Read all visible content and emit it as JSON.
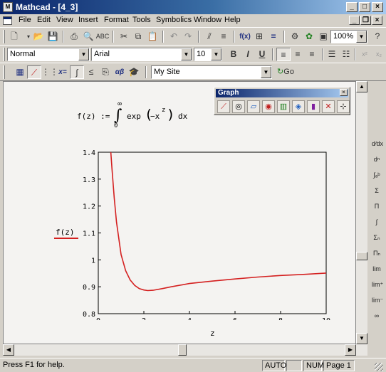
{
  "window": {
    "title": "Mathcad - [4_3]"
  },
  "menu": [
    "File",
    "Edit",
    "View",
    "Insert",
    "Format",
    "Tools",
    "Symbolics",
    "Window",
    "Help"
  ],
  "format_bar": {
    "style": "Normal",
    "font": "Arial",
    "size": "10"
  },
  "standard_bar": {
    "zoom": "100%"
  },
  "resources_bar": {
    "site": "My Site",
    "go_label": "Go"
  },
  "graph_toolbar": {
    "title": "Graph"
  },
  "equation": {
    "lhs": "f(z) :=",
    "integrand": "exp",
    "arg": "−x",
    "power": "z",
    "dx": "dx",
    "upper": "∞",
    "lower": "0"
  },
  "plot": {
    "ylabel": "f(z)",
    "xlabel": "z"
  },
  "chart_data": {
    "type": "line",
    "title": "",
    "xlabel": "z",
    "ylabel": "f(z)",
    "xlim": [
      0,
      10
    ],
    "ylim": [
      0.8,
      1.4
    ],
    "x_ticks": [
      "0",
      "2",
      "4",
      "6",
      "8",
      "10"
    ],
    "y_ticks": [
      "0.8",
      "0.9",
      "1",
      "1.1",
      "1.2",
      "1.3",
      "1.4"
    ],
    "grid": false,
    "series": [
      {
        "color": "#d42020",
        "x": [
          0.55,
          0.6,
          0.7,
          0.8,
          1.0,
          1.2,
          1.4,
          1.6,
          1.8,
          2.0,
          2.17,
          2.4,
          2.8,
          3.2,
          4.0,
          5.0,
          6.0,
          7.0,
          8.0,
          9.0,
          10.0
        ],
        "y": [
          1.4,
          1.34,
          1.23,
          1.14,
          1.02,
          0.96,
          0.925,
          0.905,
          0.893,
          0.888,
          0.886,
          0.887,
          0.893,
          0.9,
          0.912,
          0.921,
          0.929,
          0.936,
          0.942,
          0.946,
          0.951
        ]
      }
    ]
  },
  "status": {
    "help": "Press F1 for help.",
    "mode": "AUTO",
    "num": "NUM",
    "page": "Page 1"
  }
}
